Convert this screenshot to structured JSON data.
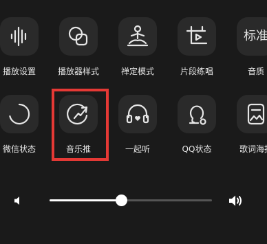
{
  "row1": [
    {
      "label": "播放设置",
      "icon": "waveform-icon"
    },
    {
      "label": "播放器样式",
      "icon": "overlapping-shapes-icon"
    },
    {
      "label": "禅定模式",
      "icon": "meditation-icon"
    },
    {
      "label": "片段练唱",
      "icon": "clip-play-icon"
    },
    {
      "label": "音质",
      "icon": "quality-text-icon",
      "tile_text": "标准"
    }
  ],
  "row2": [
    {
      "label": "微信状态",
      "icon": "ring-icon"
    },
    {
      "label": "音乐推",
      "icon": "share-arrow-icon"
    },
    {
      "label": "一起听",
      "icon": "headphones-heart-icon"
    },
    {
      "label": "QQ状态",
      "icon": "status-icon"
    },
    {
      "label": "歌词海报",
      "icon": "lyrics-poster-icon"
    }
  ],
  "volume": {
    "level": 0.44
  },
  "colors": {
    "background": "#1a1a1a",
    "tile": "#2a2a2a",
    "highlight": "#e53935"
  }
}
